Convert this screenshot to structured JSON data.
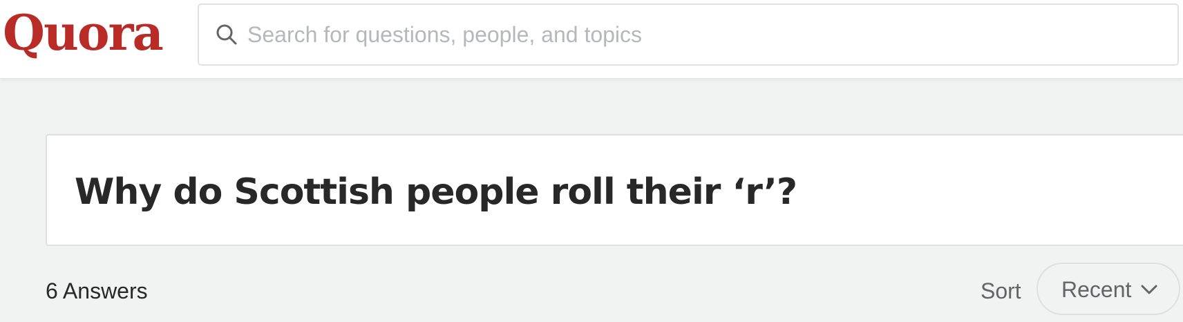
{
  "header": {
    "logo_text": "Quora",
    "search": {
      "placeholder": "Search for questions, people, and topics",
      "value": ""
    }
  },
  "question": {
    "title": "Why do Scottish people roll their ‘r’?"
  },
  "answers": {
    "count_label": "6 Answers"
  },
  "sort": {
    "label": "Sort",
    "selected": "Recent"
  },
  "icons": {
    "search": "search-icon",
    "dropdown": "chevron-down-icon"
  },
  "colors": {
    "brand": "#b92b27",
    "page_background": "#f1f2f2",
    "text_primary": "#282829",
    "text_secondary": "#636466",
    "placeholder": "#b5b8bb",
    "border": "#dfe1e2"
  }
}
